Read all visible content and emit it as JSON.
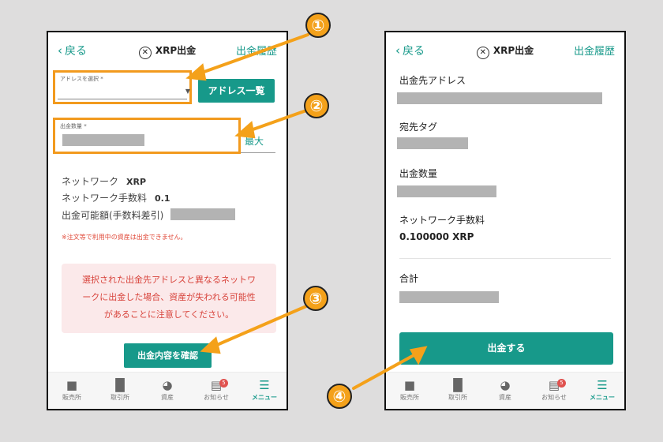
{
  "left_screen": {
    "back_label": "戻る",
    "title": "XRP出金",
    "history_label": "出金履歴",
    "address_field": {
      "label": "アドレスを選択 *",
      "value": ""
    },
    "address_list_button": "アドレス一覧",
    "amount_field": {
      "label": "出金数量 *"
    },
    "max_label": "最大",
    "network_label": "ネットワーク",
    "network_value": "XRP",
    "fee_label": "ネットワーク手数料",
    "fee_value": "0.1",
    "available_label": "出金可能額(手数料差引)",
    "note": "※注文等で利用中の資産は出金できません。",
    "warning_lines": [
      "選択された出金先アドレスと異なるネットワ",
      "ークに出金した場合、資産が失われる可能性",
      "があることに注意してください。"
    ],
    "confirm_button": "出金内容を確認"
  },
  "right_screen": {
    "back_label": "戻る",
    "title": "XRP出金",
    "history_label": "出金履歴",
    "dest_address_label": "出金先アドレス",
    "dest_tag_label": "宛先タグ",
    "amount_label": "出金数量",
    "fee_label": "ネットワーク手数料",
    "fee_value": "0.100000 XRP",
    "total_label": "合計",
    "submit_button": "出金する"
  },
  "nav": {
    "items": [
      {
        "label": "販売所",
        "icon": "store-icon"
      },
      {
        "label": "取引所",
        "icon": "chart-icon"
      },
      {
        "label": "資産",
        "icon": "pie-icon"
      },
      {
        "label": "お知らせ",
        "icon": "message-icon",
        "badge": "5"
      },
      {
        "label": "メニュー",
        "icon": "menu-icon"
      }
    ]
  },
  "annotations": [
    "①",
    "②",
    "③",
    "④"
  ],
  "colors": {
    "accent": "#17998a",
    "highlight": "#f29a1e",
    "warning_text": "#d8443c",
    "warning_bg": "#fbe9ea"
  }
}
